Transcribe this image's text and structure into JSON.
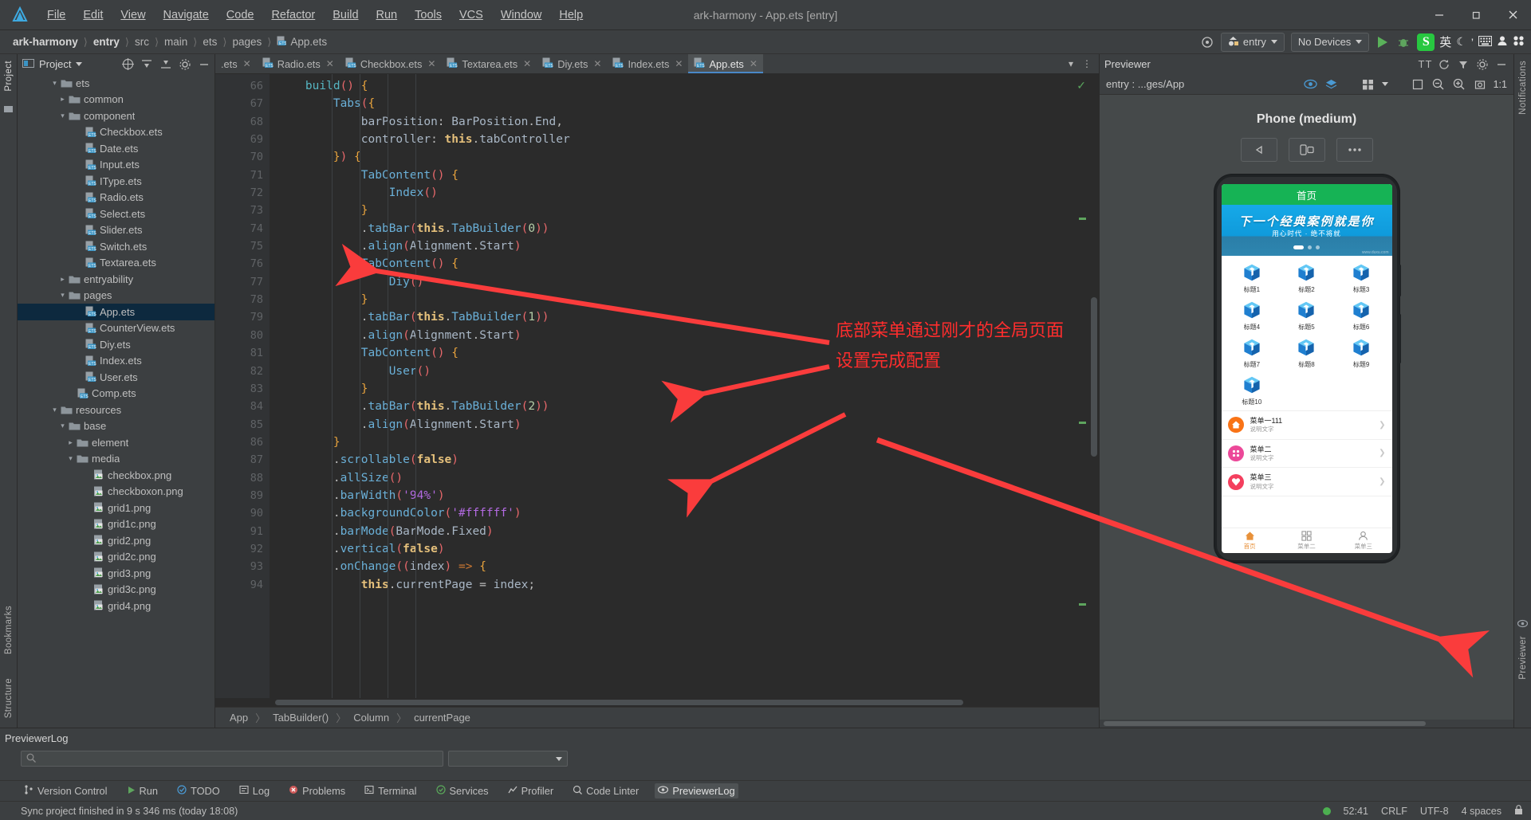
{
  "window": {
    "title": "ark-harmony - App.ets [entry]",
    "minimize": "─",
    "maximize": "❐",
    "close": "✕"
  },
  "menu": {
    "items": [
      "File",
      "Edit",
      "View",
      "Navigate",
      "Code",
      "Refactor",
      "Build",
      "Run",
      "Tools",
      "VCS",
      "Window",
      "Help"
    ]
  },
  "breadcrumb": {
    "items": [
      "ark-harmony",
      "entry",
      "src",
      "main",
      "ets",
      "pages",
      "App.ets"
    ],
    "separator": "〉"
  },
  "toolbar": {
    "target_module": "entry",
    "device": "No Devices",
    "run_tooltip": "Run",
    "debug_tooltip": "Debug",
    "ime_lang": "英",
    "settings_icon": "gear-icon"
  },
  "project_panel": {
    "title": "Project",
    "rail_labels": [
      "Project",
      "Bookmarks",
      "Structure"
    ],
    "right_rail_labels": [
      "Notifications",
      "Previewer"
    ],
    "tree": [
      {
        "label": "ets",
        "indent": 4,
        "arrow": "down",
        "icon": "folder",
        "selected": false
      },
      {
        "label": "common",
        "indent": 5,
        "arrow": "right",
        "icon": "folder",
        "selected": false
      },
      {
        "label": "component",
        "indent": 5,
        "arrow": "down",
        "icon": "folder",
        "selected": false
      },
      {
        "label": "Checkbox.ets",
        "indent": 7,
        "arrow": "none",
        "icon": "ets",
        "selected": false
      },
      {
        "label": "Date.ets",
        "indent": 7,
        "arrow": "none",
        "icon": "ets",
        "selected": false
      },
      {
        "label": "Input.ets",
        "indent": 7,
        "arrow": "none",
        "icon": "ets",
        "selected": false
      },
      {
        "label": "IType.ets",
        "indent": 7,
        "arrow": "none",
        "icon": "ets",
        "selected": false
      },
      {
        "label": "Radio.ets",
        "indent": 7,
        "arrow": "none",
        "icon": "ets",
        "selected": false
      },
      {
        "label": "Select.ets",
        "indent": 7,
        "arrow": "none",
        "icon": "ets",
        "selected": false
      },
      {
        "label": "Slider.ets",
        "indent": 7,
        "arrow": "none",
        "icon": "ets",
        "selected": false
      },
      {
        "label": "Switch.ets",
        "indent": 7,
        "arrow": "none",
        "icon": "ets",
        "selected": false
      },
      {
        "label": "Textarea.ets",
        "indent": 7,
        "arrow": "none",
        "icon": "ets",
        "selected": false
      },
      {
        "label": "entryability",
        "indent": 5,
        "arrow": "right",
        "icon": "folder",
        "selected": false
      },
      {
        "label": "pages",
        "indent": 5,
        "arrow": "down",
        "icon": "folder",
        "selected": false
      },
      {
        "label": "App.ets",
        "indent": 7,
        "arrow": "none",
        "icon": "ets",
        "selected": true
      },
      {
        "label": "CounterView.ets",
        "indent": 7,
        "arrow": "none",
        "icon": "ets",
        "selected": false
      },
      {
        "label": "Diy.ets",
        "indent": 7,
        "arrow": "none",
        "icon": "ets",
        "selected": false
      },
      {
        "label": "Index.ets",
        "indent": 7,
        "arrow": "none",
        "icon": "ets",
        "selected": false
      },
      {
        "label": "User.ets",
        "indent": 7,
        "arrow": "none",
        "icon": "ets",
        "selected": false
      },
      {
        "label": "Comp.ets",
        "indent": 6,
        "arrow": "none",
        "icon": "ets",
        "selected": false
      },
      {
        "label": "resources",
        "indent": 4,
        "arrow": "down",
        "icon": "folder",
        "selected": false
      },
      {
        "label": "base",
        "indent": 5,
        "arrow": "down",
        "icon": "folder",
        "selected": false
      },
      {
        "label": "element",
        "indent": 6,
        "arrow": "right",
        "icon": "folder",
        "selected": false
      },
      {
        "label": "media",
        "indent": 6,
        "arrow": "down",
        "icon": "folder",
        "selected": false
      },
      {
        "label": "checkbox.png",
        "indent": 8,
        "arrow": "none",
        "icon": "png",
        "selected": false
      },
      {
        "label": "checkboxon.png",
        "indent": 8,
        "arrow": "none",
        "icon": "png",
        "selected": false
      },
      {
        "label": "grid1.png",
        "indent": 8,
        "arrow": "none",
        "icon": "png",
        "selected": false
      },
      {
        "label": "grid1c.png",
        "indent": 8,
        "arrow": "none",
        "icon": "png",
        "selected": false
      },
      {
        "label": "grid2.png",
        "indent": 8,
        "arrow": "none",
        "icon": "png",
        "selected": false
      },
      {
        "label": "grid2c.png",
        "indent": 8,
        "arrow": "none",
        "icon": "png",
        "selected": false
      },
      {
        "label": "grid3.png",
        "indent": 8,
        "arrow": "none",
        "icon": "png",
        "selected": false
      },
      {
        "label": "grid3c.png",
        "indent": 8,
        "arrow": "none",
        "icon": "png",
        "selected": false
      },
      {
        "label": "grid4.png",
        "indent": 8,
        "arrow": "none",
        "icon": "png",
        "selected": false
      }
    ]
  },
  "editor": {
    "tabs": [
      {
        "label": ".ets",
        "active": false,
        "icon": "none"
      },
      {
        "label": "Radio.ets",
        "active": false,
        "icon": "ets"
      },
      {
        "label": "Checkbox.ets",
        "active": false,
        "icon": "ets"
      },
      {
        "label": "Textarea.ets",
        "active": false,
        "icon": "ets"
      },
      {
        "label": "Diy.ets",
        "active": false,
        "icon": "ets"
      },
      {
        "label": "Index.ets",
        "active": false,
        "icon": "ets"
      },
      {
        "label": "App.ets",
        "active": true,
        "icon": "ets"
      }
    ],
    "first_line_number": 66,
    "lines": [
      {
        "n": 66,
        "fold": "minus",
        "html": "    <span class='k-fn'>build</span><span class='k-par'>()</span> <span class='k-br'>{</span>"
      },
      {
        "n": 67,
        "fold": "minus",
        "html": "        <span class='k-blue'>Tabs</span><span class='k-par'>(</span><span class='k-br'>{</span>"
      },
      {
        "n": 68,
        "fold": "",
        "html": "            <span class='k-id'>barPosition</span>: <span class='k-id'>BarPosition</span>.<span class='k-id'>End</span>,"
      },
      {
        "n": 69,
        "fold": "",
        "html": "            <span class='k-id'>controller</span>: <span class='k-this'>this</span>.<span class='k-id'>tabController</span>"
      },
      {
        "n": 70,
        "fold": "plus",
        "html": "        <span class='k-br'>}</span><span class='k-par'>)</span> <span class='k-br'>{</span>"
      },
      {
        "n": 71,
        "fold": "minus",
        "html": "            <span class='k-blue'>TabContent</span><span class='k-par'>()</span> <span class='k-br'>{</span>"
      },
      {
        "n": 72,
        "fold": "",
        "html": "                <span class='k-blue'>Index</span><span class='k-par'>()</span>"
      },
      {
        "n": 73,
        "fold": "plus",
        "html": "            <span class='k-br'>}</span>"
      },
      {
        "n": 74,
        "fold": "",
        "html": "            .<span class='k-blue'>tabBar</span><span class='k-par'>(</span><span class='k-this'>this</span>.<span class='k-blue'>TabBuilder</span><span class='k-par'>(</span><span class='k-num'>0</span><span class='k-par'>))</span>"
      },
      {
        "n": 75,
        "fold": "",
        "html": "            .<span class='k-blue'>align</span><span class='k-par'>(</span><span class='k-id'>Alignment</span>.<span class='k-id'>Start</span><span class='k-par'>)</span>"
      },
      {
        "n": 76,
        "fold": "minus",
        "html": "            <span class='k-blue'>TabContent</span><span class='k-par'>()</span> <span class='k-br'>{</span>"
      },
      {
        "n": 77,
        "fold": "",
        "html": "                <span class='k-blue'>Diy</span><span class='k-par'>()</span>"
      },
      {
        "n": 78,
        "fold": "plus",
        "html": "            <span class='k-br'>}</span>"
      },
      {
        "n": 79,
        "fold": "",
        "html": "            .<span class='k-blue'>tabBar</span><span class='k-par'>(</span><span class='k-this'>this</span>.<span class='k-blue'>TabBuilder</span><span class='k-par'>(</span><span class='k-num'>1</span><span class='k-par'>))</span>"
      },
      {
        "n": 80,
        "fold": "",
        "html": "            .<span class='k-blue'>align</span><span class='k-par'>(</span><span class='k-id'>Alignment</span>.<span class='k-id'>Start</span><span class='k-par'>)</span>"
      },
      {
        "n": 81,
        "fold": "minus",
        "html": "            <span class='k-blue'>TabContent</span><span class='k-par'>()</span> <span class='k-br'>{</span>"
      },
      {
        "n": 82,
        "fold": "",
        "html": "                <span class='k-blue'>User</span><span class='k-par'>()</span>"
      },
      {
        "n": 83,
        "fold": "plus",
        "html": "            <span class='k-br'>}</span>"
      },
      {
        "n": 84,
        "fold": "",
        "html": "            .<span class='k-blue'>tabBar</span><span class='k-par'>(</span><span class='k-this'>this</span>.<span class='k-blue'>TabBuilder</span><span class='k-par'>(</span><span class='k-num'>2</span><span class='k-par'>))</span>"
      },
      {
        "n": 85,
        "fold": "",
        "html": "            .<span class='k-blue'>align</span><span class='k-par'>(</span><span class='k-id'>Alignment</span>.<span class='k-id'>Start</span><span class='k-par'>)</span>"
      },
      {
        "n": 86,
        "fold": "plus",
        "html": "        <span class='k-br'>}</span>"
      },
      {
        "n": 87,
        "fold": "",
        "html": "        .<span class='k-blue'>scrollable</span><span class='k-par'>(</span><span class='k-bool'>false</span><span class='k-par'>)</span>"
      },
      {
        "n": 88,
        "fold": "",
        "html": "        .<span class='k-blue'>allSize</span><span class='k-par'>()</span>"
      },
      {
        "n": 89,
        "fold": "",
        "html": "        .<span class='k-blue'>barWidth</span><span class='k-par'>(</span><span class='k-str'>'94%'</span><span class='k-par'>)</span>"
      },
      {
        "n": 90,
        "fold": "",
        "html": "        .<span class='k-blue'>backgroundColor</span><span class='k-par'>(</span><span class='k-str'>'#ffffff'</span><span class='k-par'>)</span>"
      },
      {
        "n": 91,
        "fold": "",
        "html": "        .<span class='k-blue'>barMode</span><span class='k-par'>(</span><span class='k-id'>BarMode</span>.<span class='k-id'>Fixed</span><span class='k-par'>)</span>"
      },
      {
        "n": 92,
        "fold": "",
        "html": "        .<span class='k-blue'>vertical</span><span class='k-par'>(</span><span class='k-bool'>false</span><span class='k-par'>)</span>"
      },
      {
        "n": 93,
        "fold": "",
        "html": "        .<span class='k-blue'>onChange</span><span class='k-par'>((</span><span class='k-id'>index</span><span class='k-par'>)</span> <span class='k-kw'>=&gt;</span> <span class='k-br'>{</span>"
      },
      {
        "n": 94,
        "fold": "",
        "html": "            <span class='k-this'>this</span>.<span class='k-id'>currentPage</span> = <span class='k-id'>index</span>;"
      }
    ],
    "status_breadcrumb": [
      "App",
      "TabBuilder()",
      "Column",
      "currentPage"
    ],
    "status_breadcrumb_sep": "〉"
  },
  "previewer": {
    "title": "Previewer",
    "path": "entry : ...ges/App",
    "device_name": "Phone (medium)",
    "zoom_label": "1:1",
    "toolbar_icons": [
      "font-size-icon",
      "refresh-icon",
      "filter-icon",
      "gear-icon",
      "minimize-icon"
    ],
    "phone": {
      "header_title": "首页",
      "banner_title": "下一个经典案例就是你",
      "banner_sub": "用心时代 · 绝不将就",
      "banner_watermark": "www.duxu.com",
      "grid_items": [
        "标题1",
        "标题2",
        "标题3",
        "标题4",
        "标题5",
        "标题6",
        "标题7",
        "标题8",
        "标题9",
        "标题10"
      ],
      "list_items": [
        {
          "title": "菜单一111",
          "sub": "说明文字",
          "color": "#f97316",
          "icon": "home-icon"
        },
        {
          "title": "菜单二",
          "sub": "说明文字",
          "color": "#ec4899",
          "icon": "apps-icon"
        },
        {
          "title": "菜单三",
          "sub": "说明文字",
          "color": "#f43f5e",
          "icon": "heart-icon"
        }
      ],
      "tabbar": [
        {
          "label": "首页",
          "active": true,
          "icon": "home-icon"
        },
        {
          "label": "菜单二",
          "active": false,
          "icon": "grid-icon"
        },
        {
          "label": "菜单三",
          "active": false,
          "icon": "user-icon"
        }
      ]
    }
  },
  "annotation": {
    "line1": "底部菜单通过刚才的全局页面",
    "line2": "设置完成配置",
    "color": "#ff2d2d"
  },
  "log_panel": {
    "title": "PreviewerLog",
    "search_placeholder": "",
    "filter_value": ""
  },
  "tool_windows": [
    {
      "label": "Version Control",
      "icon": "branch-icon",
      "active": false
    },
    {
      "label": "Run",
      "icon": "play-icon",
      "active": false
    },
    {
      "label": "TODO",
      "icon": "check-icon",
      "active": false
    },
    {
      "label": "Log",
      "icon": "log-icon",
      "active": false
    },
    {
      "label": "Problems",
      "icon": "error-icon",
      "active": false
    },
    {
      "label": "Terminal",
      "icon": "terminal-icon",
      "active": false
    },
    {
      "label": "Services",
      "icon": "services-icon",
      "active": false
    },
    {
      "label": "Profiler",
      "icon": "profiler-icon",
      "active": false
    },
    {
      "label": "Code Linter",
      "icon": "linter-icon",
      "active": false
    },
    {
      "label": "PreviewerLog",
      "icon": "preview-icon",
      "active": true
    }
  ],
  "statusbar": {
    "message": "Sync project finished in 9 s 346 ms (today 18:08)",
    "caret": "52:41",
    "line_sep": "CRLF",
    "encoding": "UTF-8",
    "indent": "4 spaces",
    "lock_icon": "lock-icon"
  }
}
